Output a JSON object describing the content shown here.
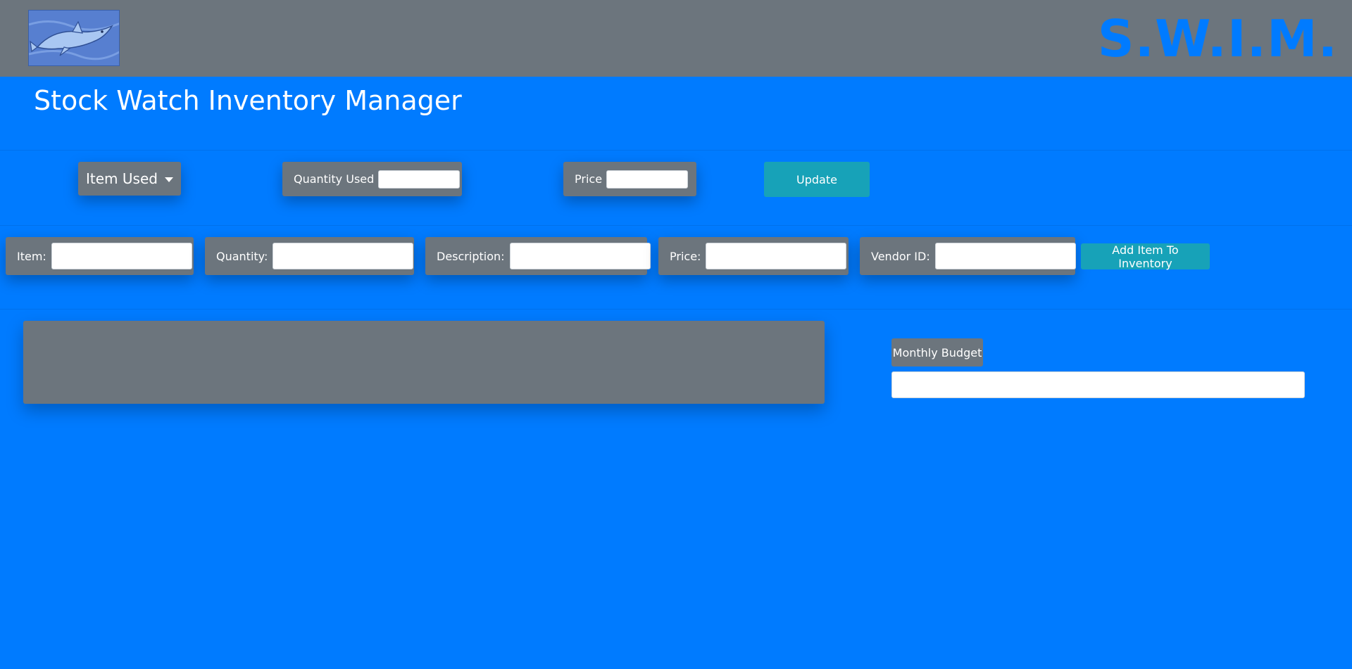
{
  "header": {
    "brand": "S.W.I.M.",
    "logo_icon": "dolphin-logo-icon"
  },
  "page": {
    "title": "Stock Watch Inventory Manager"
  },
  "usage_form": {
    "item_dropdown_label": "Item Used",
    "quantity_label": "Quantity Used",
    "quantity_value": "",
    "price_label": "Price",
    "price_value": "",
    "update_label": "Update"
  },
  "add_form": {
    "item_label": "Item:",
    "item_value": "",
    "quantity_label": "Quantity:",
    "quantity_value": "",
    "description_label": "Description:",
    "description_value": "",
    "price_label": "Price:",
    "price_value": "",
    "vendor_label": "Vendor ID:",
    "vendor_value": "",
    "add_button_label": "Add Item To Inventory"
  },
  "budget": {
    "label": "Monthly Budget",
    "value": ""
  },
  "colors": {
    "background": "#007bff",
    "panel": "#6c757d",
    "accent_button": "#17a2b8",
    "brand_text": "#007bff"
  }
}
